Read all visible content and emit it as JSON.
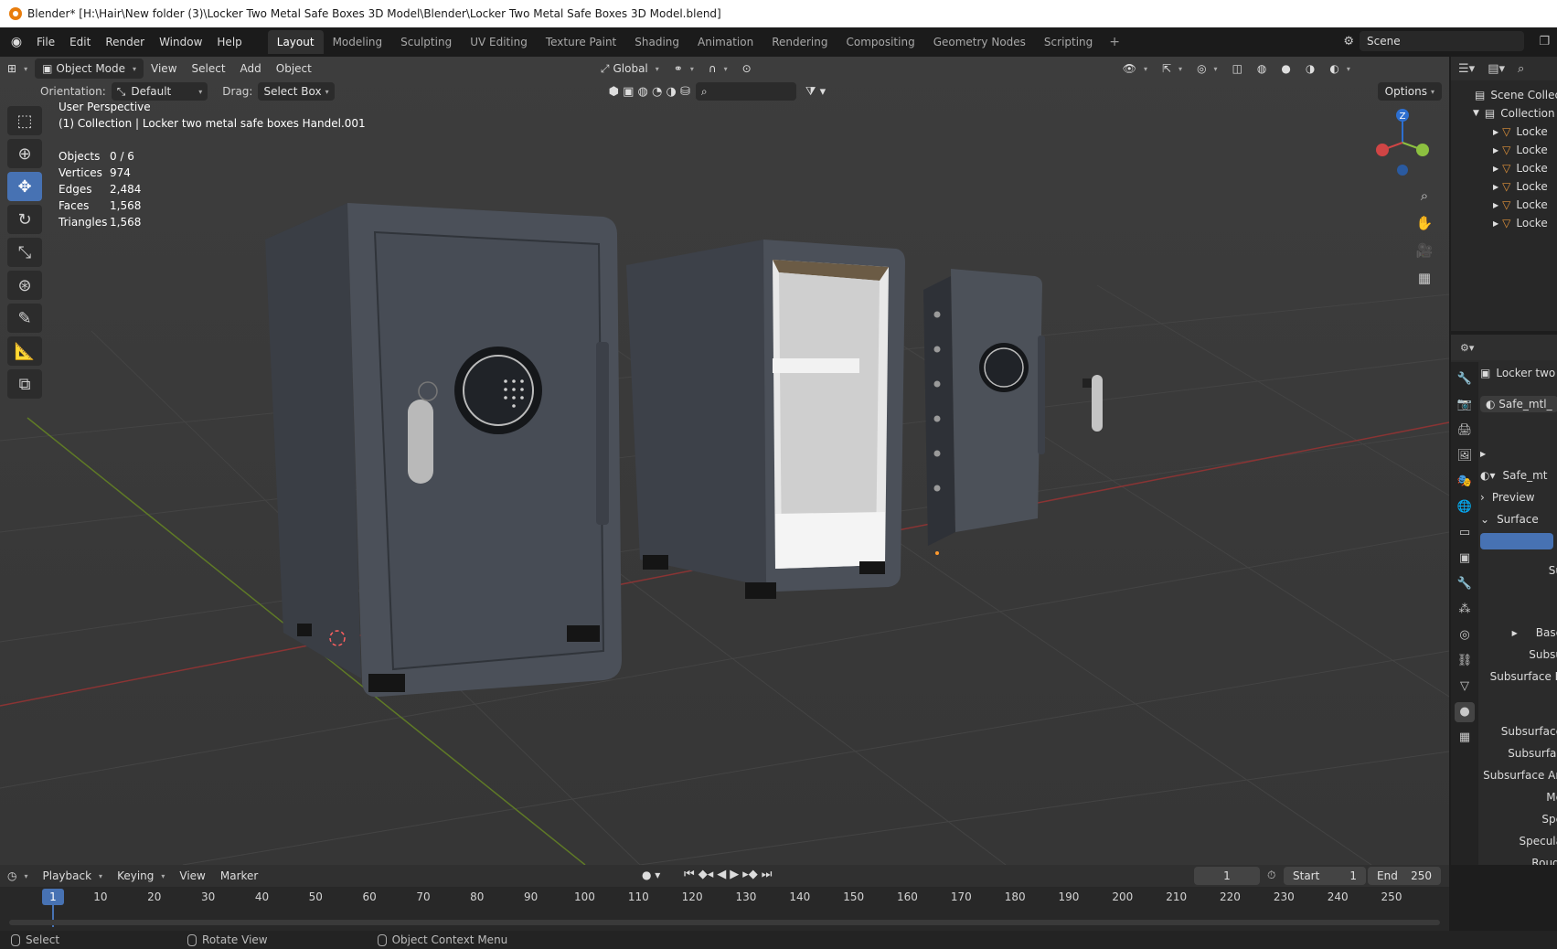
{
  "title": "Blender* [H:\\Hair\\New folder (3)\\Locker Two Metal Safe Boxes 3D Model\\Blender\\Locker Two Metal Safe Boxes 3D Model.blend]",
  "menu": [
    "File",
    "Edit",
    "Render",
    "Window",
    "Help"
  ],
  "workspaces": [
    "Layout",
    "Modeling",
    "Sculpting",
    "UV Editing",
    "Texture Paint",
    "Shading",
    "Animation",
    "Rendering",
    "Compositing",
    "Geometry Nodes",
    "Scripting"
  ],
  "active_workspace": "Layout",
  "scene_name": "Scene",
  "viewport_header": {
    "mode": "Object Mode",
    "menus": [
      "View",
      "Select",
      "Add",
      "Object"
    ],
    "transform_space": "Global"
  },
  "viewport_row2": {
    "orientation_label": "Orientation:",
    "orientation_value": "Default",
    "drag_label": "Drag:",
    "drag_value": "Select Box",
    "options": "Options"
  },
  "overlay": {
    "view_name": "User Perspective",
    "collection_info": "(1) Collection | Locker two metal safe boxes Handel.001"
  },
  "stats": [
    {
      "k": "Objects",
      "v": "0 / 6"
    },
    {
      "k": "Vertices",
      "v": "974"
    },
    {
      "k": "Edges",
      "v": "2,484"
    },
    {
      "k": "Faces",
      "v": "1,568"
    },
    {
      "k": "Triangles",
      "v": "1,568"
    }
  ],
  "gizmo": {
    "z": "Z"
  },
  "outliner": {
    "scene_collection": "Scene Collecti",
    "collection": "Collection",
    "items": [
      "Locke",
      "Locke",
      "Locke",
      "Locke",
      "Locke",
      "Locke"
    ]
  },
  "properties": {
    "object_name": "Locker two",
    "material_slot": "Safe_mtl_",
    "material_name": "Safe_mt",
    "panels": [
      "Preview",
      "Surface"
    ],
    "fields": [
      "Su",
      "Base",
      "Subsu",
      "Subsurface R",
      "Subsurface",
      "Subsurfac",
      "Subsurface An",
      "Me",
      "Spe",
      "Specula",
      "Rougl"
    ]
  },
  "timeline": {
    "menus": [
      "Playback",
      "Keying",
      "View",
      "Marker"
    ],
    "current_frame": "1",
    "start_label": "Start",
    "start": "1",
    "end_label": "End",
    "end": "250",
    "ticks": [
      "1",
      "10",
      "20",
      "30",
      "40",
      "50",
      "60",
      "70",
      "80",
      "90",
      "100",
      "110",
      "120",
      "130",
      "140",
      "150",
      "160",
      "170",
      "180",
      "190",
      "200",
      "210",
      "220",
      "230",
      "240",
      "250"
    ]
  },
  "statusbar": [
    "Select",
    "Rotate View",
    "Object Context Menu"
  ],
  "colors": {
    "accent": "#4772b3",
    "viewport_bg": "#393939",
    "grid_x_axis": "#a63c3c",
    "grid_y_axis": "#6b8a2b",
    "safe_body": "#4a4f57"
  }
}
